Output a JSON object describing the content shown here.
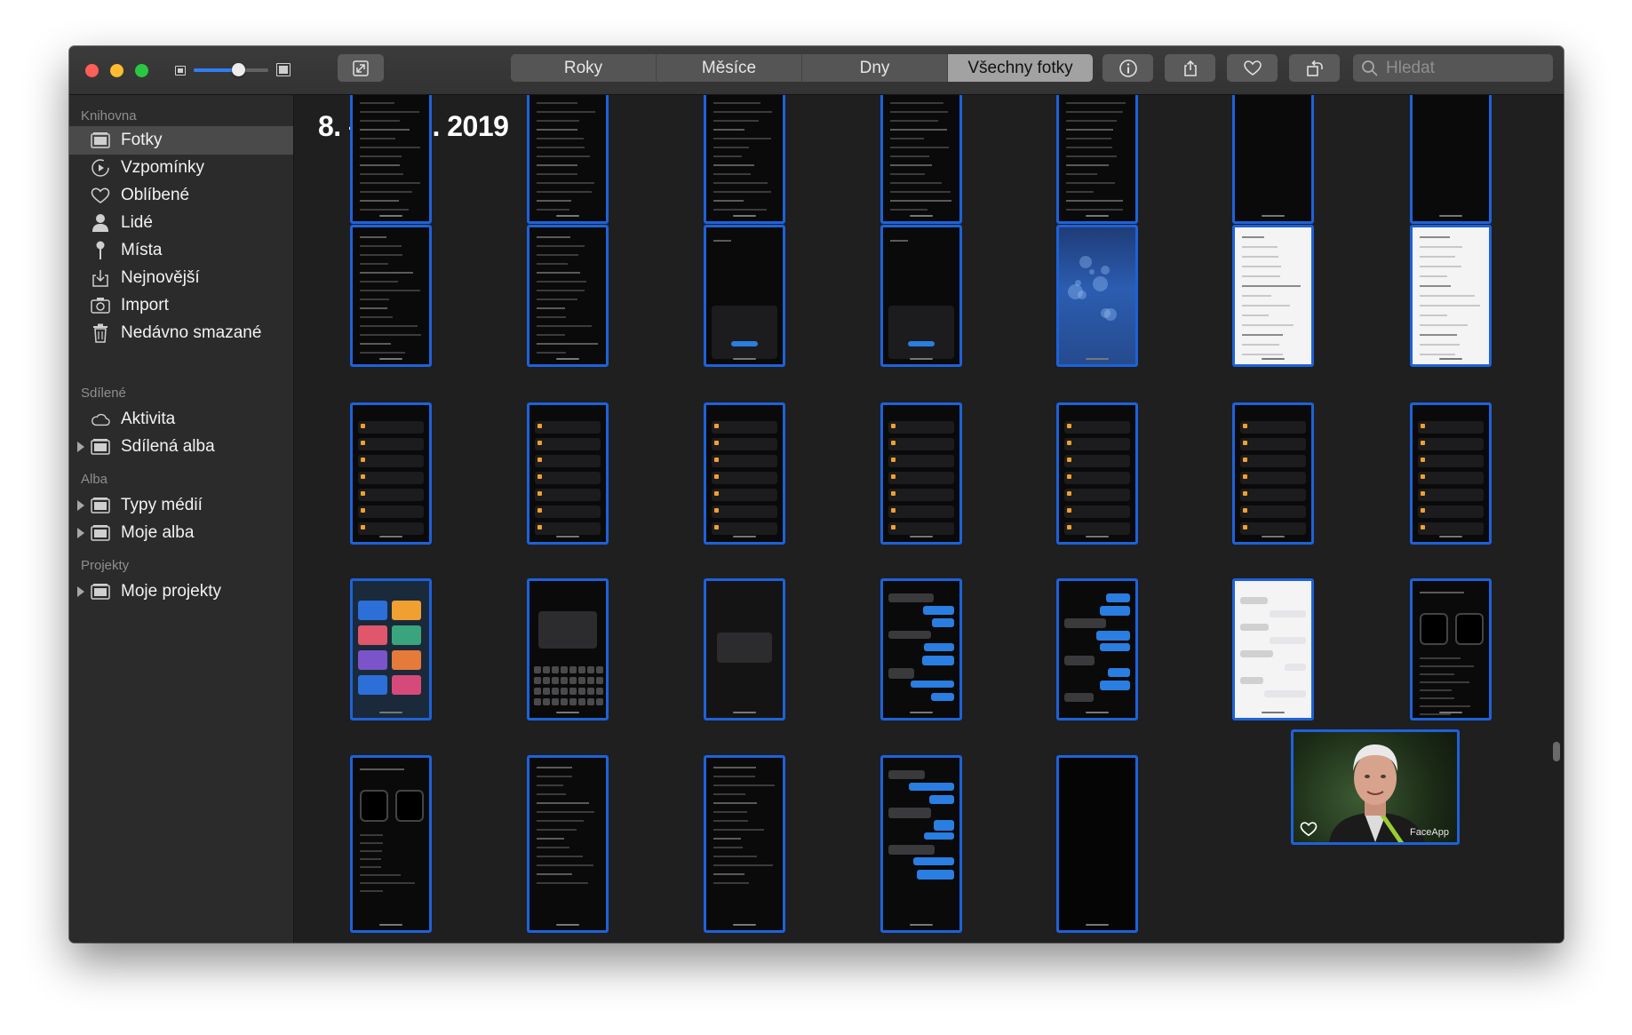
{
  "toolbar": {
    "zoom_level": 0.6,
    "segments": [
      {
        "label": "Roky",
        "active": false
      },
      {
        "label": "Měsíce",
        "active": false
      },
      {
        "label": "Dny",
        "active": false
      },
      {
        "label": "Všechny fotky",
        "active": true
      }
    ],
    "search_placeholder": "Hledat",
    "accent_color": "#2f7df6"
  },
  "sidebar": {
    "library_header": "Knihovna",
    "library_items": [
      {
        "label": "Fotky",
        "icon": "photos-icon",
        "active": true
      },
      {
        "label": "Vzpomínky",
        "icon": "memories-icon"
      },
      {
        "label": "Oblíbené",
        "icon": "heart-icon"
      },
      {
        "label": "Lidé",
        "icon": "person-icon"
      },
      {
        "label": "Místa",
        "icon": "pin-icon"
      },
      {
        "label": "Nejnovější",
        "icon": "import-arrow-icon"
      },
      {
        "label": "Import",
        "icon": "camera-icon"
      },
      {
        "label": "Nedávno smazané",
        "icon": "trash-icon"
      }
    ],
    "shared_header": "Sdílené",
    "shared_items": [
      {
        "label": "Aktivita",
        "icon": "cloud-icon"
      },
      {
        "label": "Sdílená alba",
        "icon": "folder-icon",
        "expandable": true
      }
    ],
    "albums_header": "Alba",
    "album_items": [
      {
        "label": "Typy médií",
        "icon": "folder-icon",
        "expandable": true
      },
      {
        "label": "Moje alba",
        "icon": "folder-icon",
        "expandable": true
      }
    ],
    "projects_header": "Projekty",
    "project_items": [
      {
        "label": "Moje projekty",
        "icon": "folder-icon",
        "expandable": true
      }
    ]
  },
  "main": {
    "date_range": "8. – 17. 7. 2019",
    "faceapp_caption": "FaceApp",
    "selection_color": "#1d62db"
  }
}
